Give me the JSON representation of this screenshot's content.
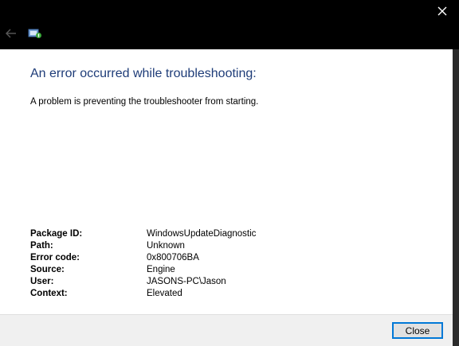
{
  "dialog": {
    "heading": "An error occurred while troubleshooting:",
    "message": "A problem is preventing the troubleshooter from starting."
  },
  "details": [
    {
      "label": "Package ID:",
      "value": "WindowsUpdateDiagnostic"
    },
    {
      "label": "Path:",
      "value": "Unknown"
    },
    {
      "label": "Error code:",
      "value": "0x800706BA"
    },
    {
      "label": "Source:",
      "value": "Engine"
    },
    {
      "label": "User:",
      "value": "JASONS-PC\\Jason"
    },
    {
      "label": "Context:",
      "value": "Elevated"
    }
  ],
  "footer": {
    "close_label": "Close"
  },
  "icons": {
    "window_close": "close-icon",
    "back": "back-arrow-icon",
    "app": "troubleshooter-icon"
  },
  "colors": {
    "heading": "#1e3c78",
    "title_bar": "#000000",
    "content_bg": "#ffffff",
    "footer_bg": "#f0f0f0",
    "button_focus_border": "#0078d7"
  }
}
